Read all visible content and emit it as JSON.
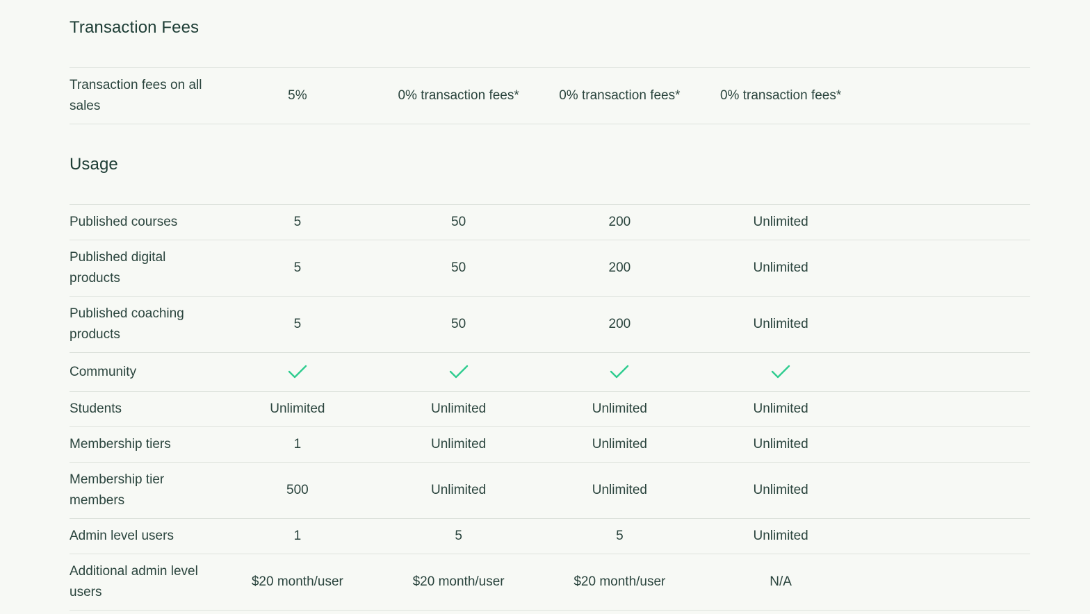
{
  "sections": {
    "fees": {
      "title": "Transaction Fees",
      "rows": [
        {
          "label": "Transaction fees on all sales",
          "values": [
            "5%",
            "0% transaction fees*",
            "0% transaction fees*",
            "0% transaction fees*"
          ]
        }
      ]
    },
    "usage": {
      "title": "Usage",
      "rows": [
        {
          "label": "Published courses",
          "values": [
            "5",
            "50",
            "200",
            "Unlimited"
          ]
        },
        {
          "label": "Published digital products",
          "values": [
            "5",
            "50",
            "200",
            "Unlimited"
          ]
        },
        {
          "label": "Published coaching products",
          "values": [
            "5",
            "50",
            "200",
            "Unlimited"
          ]
        },
        {
          "label": "Community",
          "values": [
            "check-icon",
            "check-icon",
            "check-icon",
            "check-icon"
          ]
        },
        {
          "label": "Students",
          "values": [
            "Unlimited",
            "Unlimited",
            "Unlimited",
            "Unlimited"
          ]
        },
        {
          "label": "Membership tiers",
          "values": [
            "1",
            "Unlimited",
            "Unlimited",
            "Unlimited"
          ]
        },
        {
          "label": "Membership tier members",
          "values": [
            "500",
            "Unlimited",
            "Unlimited",
            "Unlimited"
          ]
        },
        {
          "label": "Admin level users",
          "values": [
            "1",
            "5",
            "5",
            "Unlimited"
          ]
        },
        {
          "label": "Additional admin level users",
          "values": [
            "$20 month/user",
            "$20 month/user",
            "$20 month/user",
            "N/A"
          ]
        }
      ]
    }
  },
  "colors": {
    "background": "#f7f9f5",
    "heading": "#1d3d35",
    "text": "#2a443d",
    "divider": "#dde2dc",
    "check": "#2ecc8f"
  }
}
